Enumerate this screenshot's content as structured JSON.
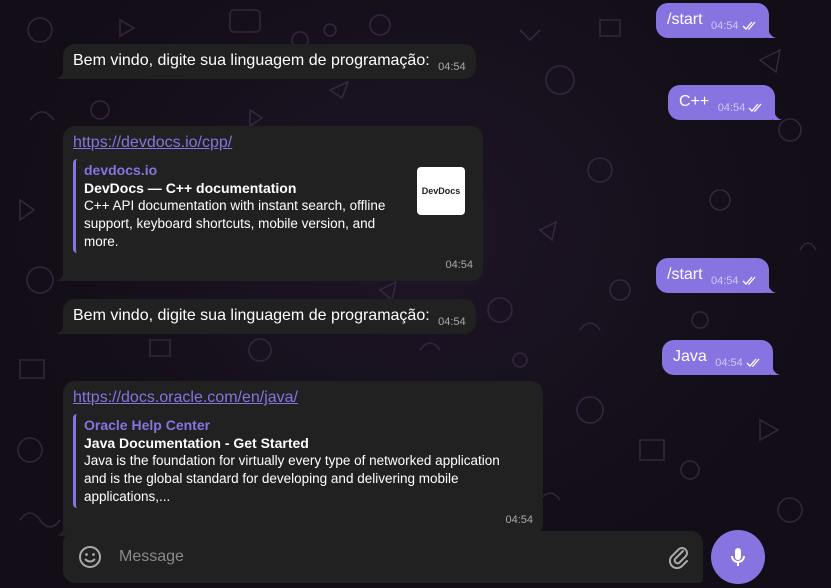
{
  "messages": [
    {
      "id": "m1",
      "text": "/start",
      "time": "04:54"
    },
    {
      "id": "m2",
      "text": "Bem vindo, digite sua linguagem de programação:",
      "time": "04:54"
    },
    {
      "id": "m3",
      "text": "C++",
      "time": "04:54"
    },
    {
      "id": "m4",
      "link": "https://devdocs.io/cpp/",
      "site": "devdocs.io",
      "title": "DevDocs — C++ documentation",
      "description": "C++  API documentation with instant search, offline support, keyboard shortcuts, mobile version, and more.",
      "thumb": "DevDocs",
      "time": "04:54"
    },
    {
      "id": "m5",
      "text": "/start",
      "time": "04:54"
    },
    {
      "id": "m6",
      "text": "Bem vindo, digite sua linguagem de programação:",
      "time": "04:54"
    },
    {
      "id": "m7",
      "text": "Java",
      "time": "04:54"
    },
    {
      "id": "m8",
      "link": "https://docs.oracle.com/en/java/",
      "site": "Oracle Help Center",
      "title": "Java Documentation - Get Started",
      "description": "Java is the foundation for virtually every type of networked application and is the global standard for developing and delivering mobile applications,...",
      "time": "04:54"
    }
  ],
  "composer": {
    "placeholder": "Message"
  },
  "icons": {
    "emoji": "smile-icon",
    "attach": "paperclip-icon",
    "mic": "microphone-icon",
    "read": "double-check-icon"
  },
  "colors": {
    "accent": "#8774e1",
    "incoming": "#212121",
    "background": "#120d16"
  }
}
